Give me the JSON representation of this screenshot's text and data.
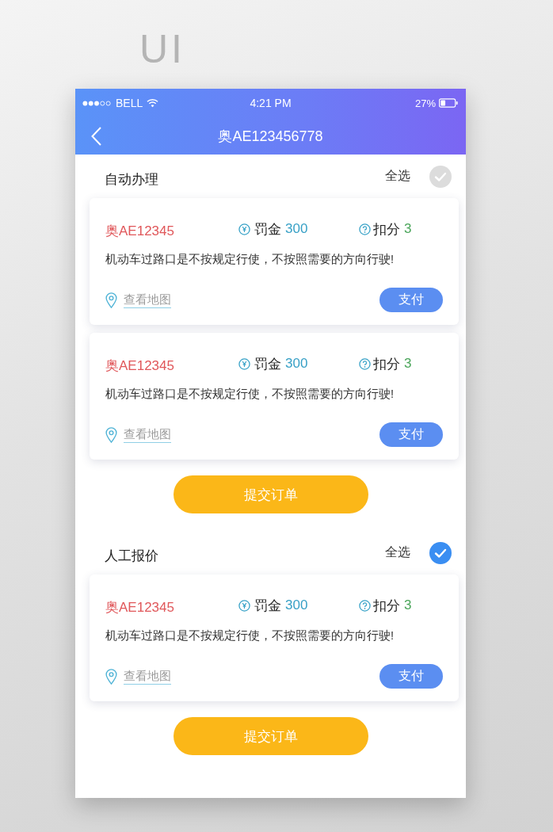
{
  "title": "UI",
  "status_bar": {
    "carrier": "BELL",
    "time": "4:21 PM",
    "battery": "27%"
  },
  "nav": {
    "title": "奥AE123456778"
  },
  "sections": [
    {
      "title": "自动办理",
      "select_all": {
        "label": "全选",
        "checked": false
      },
      "cards": [
        {
          "plate": "奥AE12345",
          "fine_label": "罚金",
          "fine": "300",
          "points_label": "扣分",
          "points": "3",
          "description": "机动车过路口是不按规定行使，不按照需要的方向行驶!",
          "map_link": "查看地图",
          "action": "支付"
        },
        {
          "plate": "奥AE12345",
          "fine_label": "罚金",
          "fine": "300",
          "points_label": "扣分",
          "points": "3",
          "description": "机动车过路口是不按规定行使，不按照需要的方向行驶!",
          "map_link": "查看地图",
          "action": "支付"
        }
      ],
      "submit": "提交订单"
    },
    {
      "title": "人工报价",
      "select_all": {
        "label": "全选",
        "checked": true
      },
      "cards": [
        {
          "plate": "奥AE12345",
          "fine_label": "罚金",
          "fine": "300",
          "points_label": "扣分",
          "points": "3",
          "description": "机动车过路口是不按规定行使，不按照需要的方向行驶!",
          "map_link": "查看地图",
          "action": "支付"
        }
      ],
      "submit": "提交订单"
    }
  ]
}
